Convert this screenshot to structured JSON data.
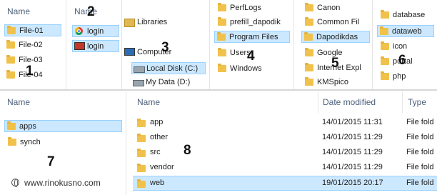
{
  "panels": {
    "p1": {
      "header": "Name",
      "items": [
        "File-01",
        "File-02",
        "File-03",
        "File-04"
      ],
      "selected": "File-01"
    },
    "p2": {
      "header": "Name",
      "items": [
        "login",
        "login"
      ]
    },
    "p3": {
      "items": [
        "Libraries",
        "Computer",
        "Local Disk (C:)",
        "My Data (D:)"
      ]
    },
    "p4": {
      "items": [
        "PerfLogs",
        "prefill_dapodik",
        "Program Files",
        "Users",
        "Windows"
      ],
      "selected": "Program Files"
    },
    "p5": {
      "items": [
        "Canon",
        "Common Fil",
        "Dapodikdas",
        "Google",
        "Internet Expl",
        "KMSpico"
      ],
      "selected": "Dapodikdas"
    },
    "p6": {
      "items": [
        "database",
        "dataweb",
        "icon",
        "portal",
        "php"
      ],
      "selected": "dataweb"
    }
  },
  "markers": [
    "1",
    "2",
    "3",
    "4",
    "5",
    "6",
    "7",
    "8"
  ],
  "bottom_left": {
    "header": "Name",
    "items": [
      "apps",
      "synch"
    ],
    "selected": "apps"
  },
  "table": {
    "columns": [
      "Name",
      "Date modified",
      "Type"
    ],
    "rows": [
      {
        "name": "app",
        "date": "14/01/2015 11:31",
        "type": "File fold"
      },
      {
        "name": "other",
        "date": "14/01/2015 11:29",
        "type": "File fold"
      },
      {
        "name": "src",
        "date": "14/01/2015 11:29",
        "type": "File fold"
      },
      {
        "name": "vendor",
        "date": "14/01/2015 11:29",
        "type": "File fold"
      },
      {
        "name": "web",
        "date": "19/01/2015 20:17",
        "type": "File fold"
      }
    ],
    "selected": "web"
  },
  "watermark": "www.rinokusno.com",
  "colors": {
    "selection": "#cce8ff",
    "selection_border": "#99d1ff",
    "folder": "#f1c24b",
    "header_text": "#4c607a"
  }
}
